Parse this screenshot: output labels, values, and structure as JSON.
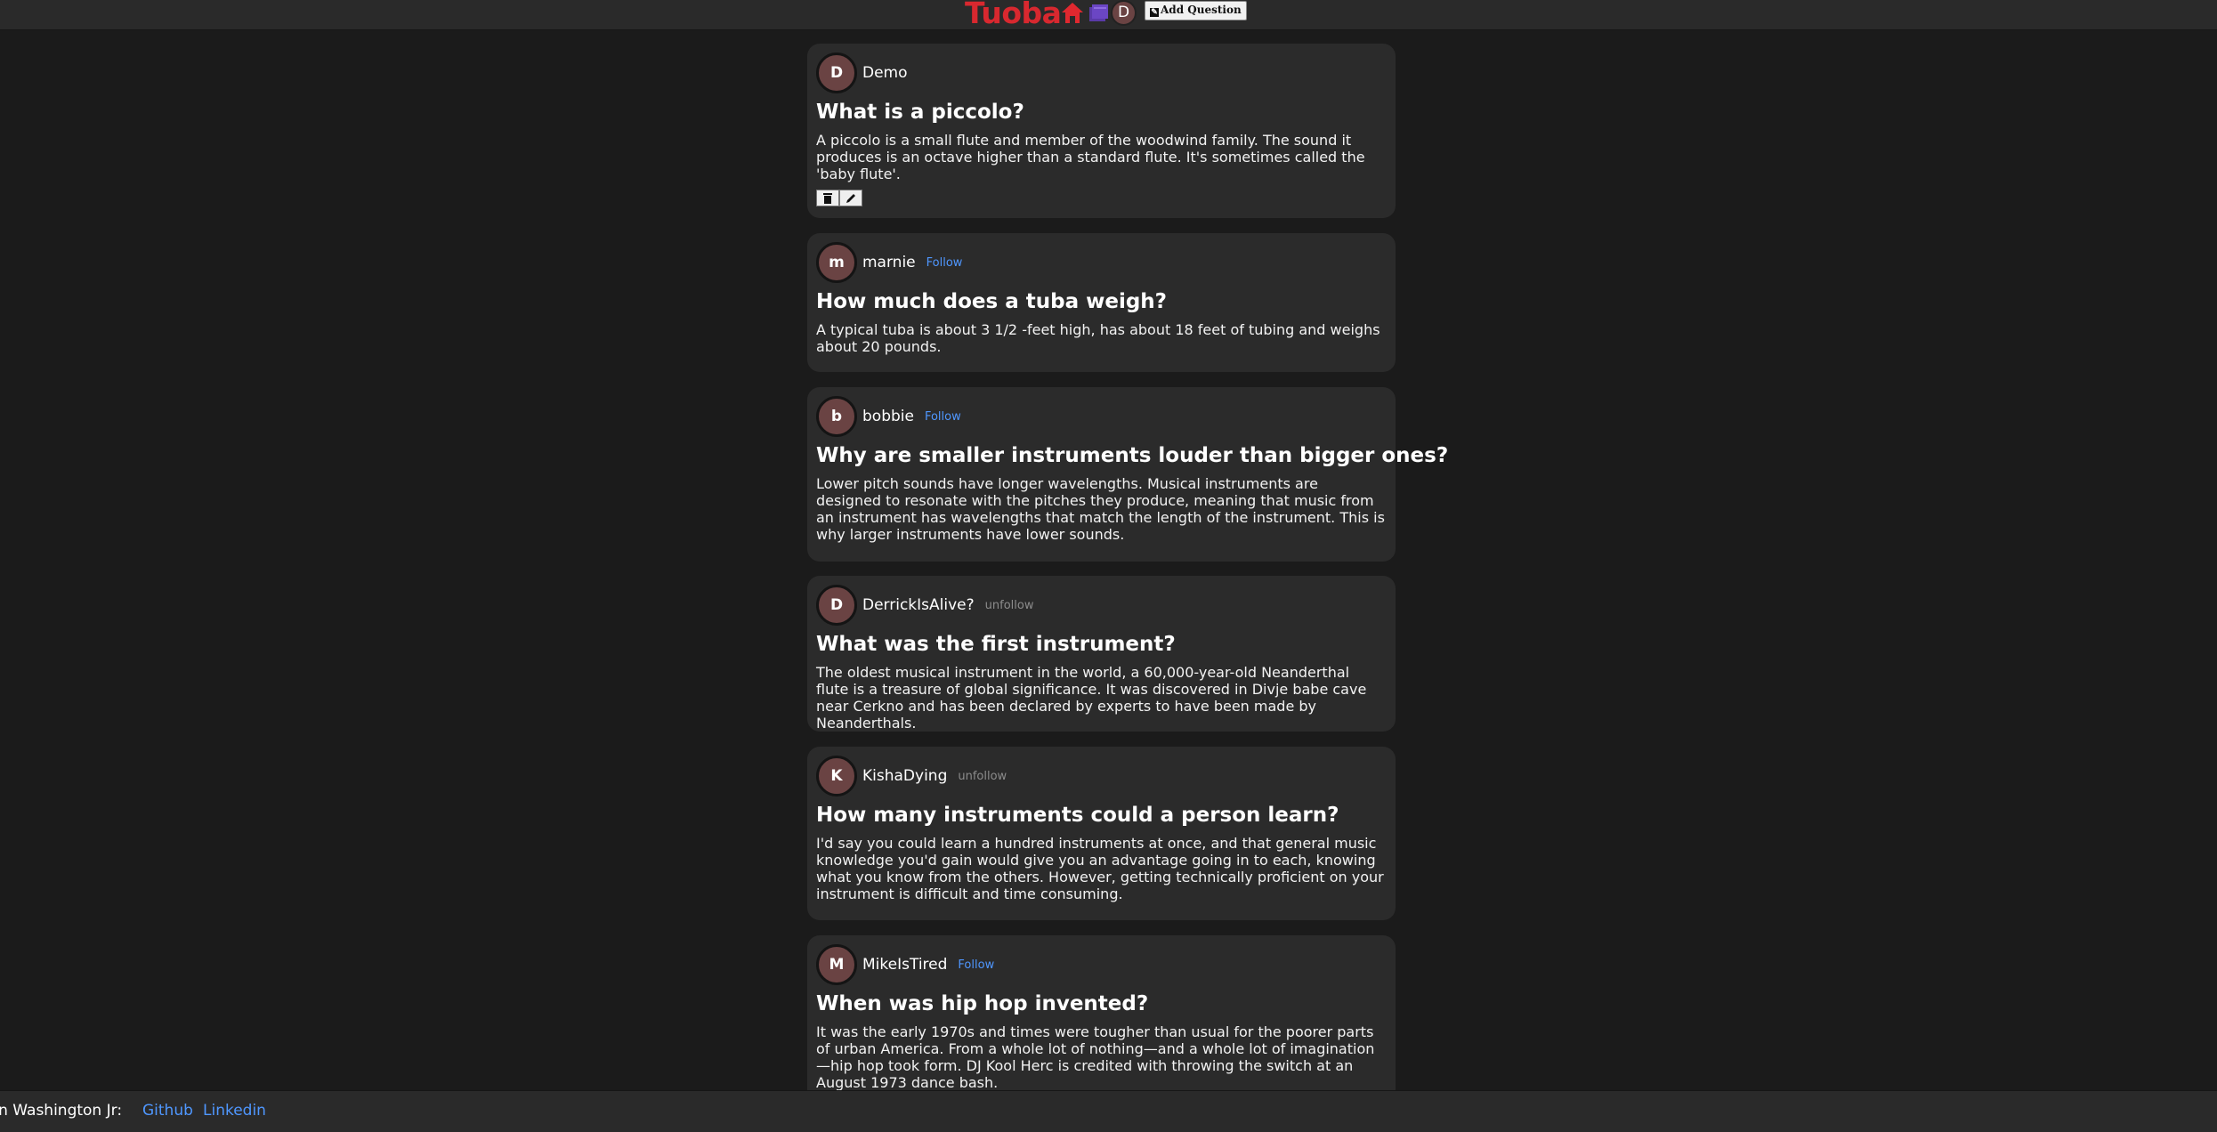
{
  "nav": {
    "brand": "Tuoba",
    "avatar_initial": "D",
    "add_question_label": "Add Question",
    "brand_color": "#d8282f",
    "home_icon": "home-icon",
    "library_icon": "books-icon"
  },
  "cards": [
    {
      "initial": "D",
      "username": "Demo",
      "follow": "",
      "title": "What is a piccolo?",
      "body": "A piccolo is a small flute and member of the woodwind family. The sound it produces is an octave higher than a standard flute. It's sometimes called the 'baby flute'.",
      "actions": [
        "trash-icon",
        "pencil-icon"
      ]
    },
    {
      "initial": "m",
      "username": "marnie",
      "follow": "Follow",
      "title": "How much does a tuba weigh?",
      "body": "A typical tuba is about 3 1/2 -feet high, has about 18 feet of tubing and weighs about 20 pounds."
    },
    {
      "initial": "b",
      "username": "bobbie",
      "follow": "Follow",
      "title": "Why are smaller instruments louder than bigger ones?",
      "body": "Lower pitch sounds have longer wavelengths. Musical instruments are designed to resonate with the pitches they produce, meaning that music from an instrument has wavelengths that match the length of the instrument. This is why larger instruments have lower sounds."
    },
    {
      "initial": "D",
      "username": "DerrickIsAlive?",
      "follow": "unfollow",
      "title": "What was the first instrument?",
      "body": "The oldest musical instrument in the world, a 60,000-year-old Neanderthal flute is a treasure of global significance. It was discovered in Divje babe cave near Cerkno and has been declared by experts to have been made by Neanderthals."
    },
    {
      "initial": "K",
      "username": "KishaDying",
      "follow": "unfollow",
      "title": "How many instruments could a person learn?",
      "body": "I'd say you could learn a hundred instruments at once, and that general music knowledge you'd gain would give you an advantage going in to each, knowing what you know from the others. However, getting technically proficient on your instrument is difficult and time consuming."
    },
    {
      "initial": "M",
      "username": "MikeIsTired",
      "follow": "Follow",
      "title": "When was hip hop invented?",
      "body": "It was the early 1970s and times were tougher than usual for the poorer parts of urban America. From a whole lot of nothing—and a whole lot of imagination—hip hop took form. DJ Kool Herc is credited with throwing the switch at an August 1973 dance bash."
    }
  ],
  "footer": {
    "credit": "rian Washington Jr:",
    "github": "Github",
    "linkedin": "Linkedin"
  }
}
